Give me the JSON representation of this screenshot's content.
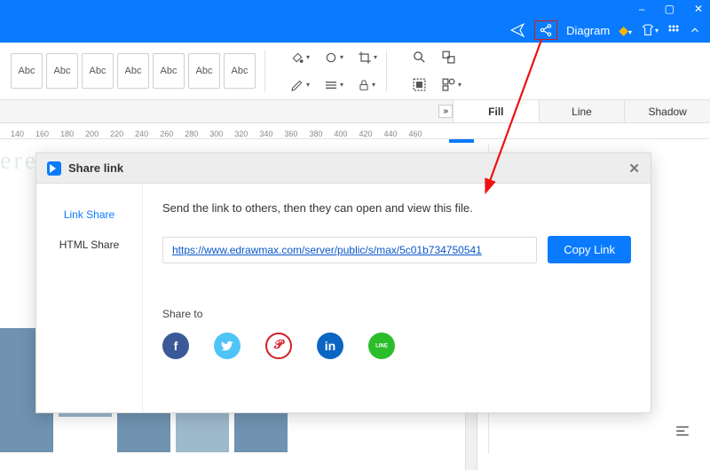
{
  "title_hint": "Diagram",
  "window": {
    "minimize": "–",
    "restore": "▢",
    "close": "✕"
  },
  "menubar": {
    "send_icon": "send-icon",
    "share_icon": "share-icon",
    "label_diagram": "Diagram",
    "diamond_icon": "diamond-icon",
    "tshirt_icon": "tshirt-icon",
    "grid_icon": "grid-icon",
    "chevron_icon": "chevron-up-icon"
  },
  "shape_label": "Abc",
  "ruler": [
    "140",
    "160",
    "180",
    "200",
    "220",
    "240",
    "260",
    "280",
    "300",
    "320",
    "340",
    "360",
    "380",
    "400",
    "420",
    "440",
    "460"
  ],
  "properties": {
    "expand": "»",
    "tabs": {
      "fill": "Fill",
      "line": "Line",
      "shadow": "Shadow"
    }
  },
  "canvas": {
    "here_text": "ere"
  },
  "dialog": {
    "title": "Share link",
    "close": "✕",
    "sidebar": {
      "link": "Link Share",
      "html": "HTML Share"
    },
    "message": "Send the link to others, then they can open and view this file.",
    "url": "https://www.edrawmax.com/server/public/s/max/5c01b734750541",
    "copy_btn": "Copy Link",
    "share_to": "Share to",
    "socials": {
      "fb": "f",
      "tw": "🐦",
      "pin": "𝒫",
      "li": "in",
      "ln": "✆"
    }
  }
}
